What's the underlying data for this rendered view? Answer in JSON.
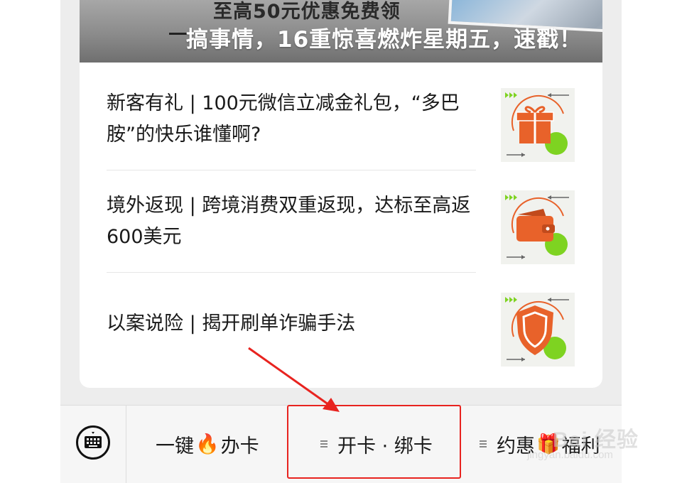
{
  "banner": {
    "subtitle": "至高50元优惠免费领",
    "title": "搞事情，16重惊喜燃炸星期五，速戳！"
  },
  "articles": [
    {
      "title": "新客有礼 | 100元微信立减金礼包，“多巴胺”的快乐谁懂啊?",
      "thumbnail_icon": "gift-icon"
    },
    {
      "title": "境外返现 | 跨境消费双重返现，达标至高返600美元",
      "thumbnail_icon": "wallet-icon"
    },
    {
      "title": "以案说险 | 揭开刷单诈骗手法",
      "thumbnail_icon": "shield-icon"
    }
  ],
  "bottom_nav": {
    "keyboard_icon": "keyboard-icon",
    "items": [
      {
        "label_a": "一键",
        "emoji": "🔥",
        "label_b": "办卡"
      },
      {
        "label": "开卡 · 绑卡"
      },
      {
        "label_a": "约惠",
        "emoji": "🎁",
        "label_b": "福利"
      }
    ]
  },
  "annotation": {
    "color": "#e8231f"
  },
  "watermark": {
    "text": "Bai 经验",
    "url": "jingyan.baidu.com"
  },
  "colors": {
    "accent_orange": "#e8622a",
    "accent_green": "#7ed321",
    "background": "#ededed"
  }
}
